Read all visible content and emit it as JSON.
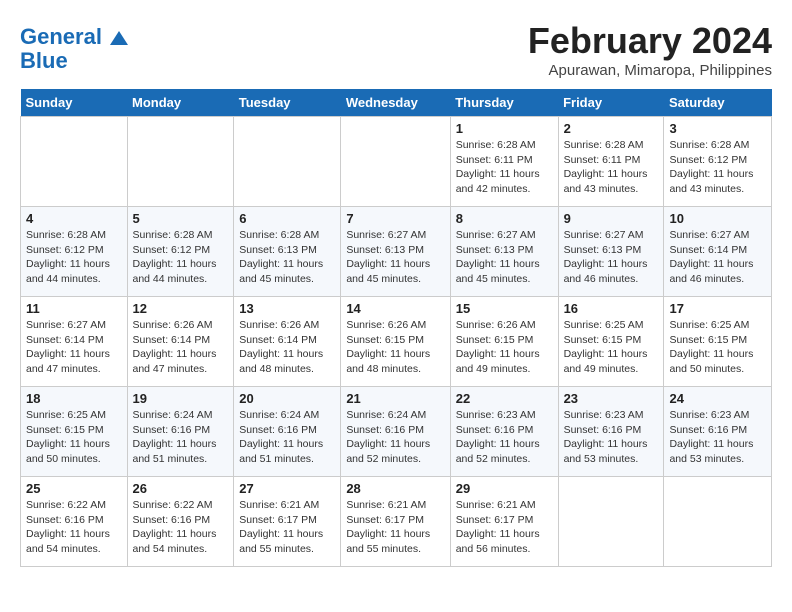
{
  "header": {
    "logo_line1": "General",
    "logo_line2": "Blue",
    "month_year": "February 2024",
    "location": "Apurawan, Mimaropa, Philippines"
  },
  "days_of_week": [
    "Sunday",
    "Monday",
    "Tuesday",
    "Wednesday",
    "Thursday",
    "Friday",
    "Saturday"
  ],
  "weeks": [
    [
      {
        "day": "",
        "empty": true
      },
      {
        "day": "",
        "empty": true
      },
      {
        "day": "",
        "empty": true
      },
      {
        "day": "",
        "empty": true
      },
      {
        "day": "1",
        "sunrise": "6:28 AM",
        "sunset": "6:11 PM",
        "daylight": "11 hours and 42 minutes."
      },
      {
        "day": "2",
        "sunrise": "6:28 AM",
        "sunset": "6:11 PM",
        "daylight": "11 hours and 43 minutes."
      },
      {
        "day": "3",
        "sunrise": "6:28 AM",
        "sunset": "6:12 PM",
        "daylight": "11 hours and 43 minutes."
      }
    ],
    [
      {
        "day": "4",
        "sunrise": "6:28 AM",
        "sunset": "6:12 PM",
        "daylight": "11 hours and 44 minutes."
      },
      {
        "day": "5",
        "sunrise": "6:28 AM",
        "sunset": "6:12 PM",
        "daylight": "11 hours and 44 minutes."
      },
      {
        "day": "6",
        "sunrise": "6:28 AM",
        "sunset": "6:13 PM",
        "daylight": "11 hours and 45 minutes."
      },
      {
        "day": "7",
        "sunrise": "6:27 AM",
        "sunset": "6:13 PM",
        "daylight": "11 hours and 45 minutes."
      },
      {
        "day": "8",
        "sunrise": "6:27 AM",
        "sunset": "6:13 PM",
        "daylight": "11 hours and 45 minutes."
      },
      {
        "day": "9",
        "sunrise": "6:27 AM",
        "sunset": "6:13 PM",
        "daylight": "11 hours and 46 minutes."
      },
      {
        "day": "10",
        "sunrise": "6:27 AM",
        "sunset": "6:14 PM",
        "daylight": "11 hours and 46 minutes."
      }
    ],
    [
      {
        "day": "11",
        "sunrise": "6:27 AM",
        "sunset": "6:14 PM",
        "daylight": "11 hours and 47 minutes."
      },
      {
        "day": "12",
        "sunrise": "6:26 AM",
        "sunset": "6:14 PM",
        "daylight": "11 hours and 47 minutes."
      },
      {
        "day": "13",
        "sunrise": "6:26 AM",
        "sunset": "6:14 PM",
        "daylight": "11 hours and 48 minutes."
      },
      {
        "day": "14",
        "sunrise": "6:26 AM",
        "sunset": "6:15 PM",
        "daylight": "11 hours and 48 minutes."
      },
      {
        "day": "15",
        "sunrise": "6:26 AM",
        "sunset": "6:15 PM",
        "daylight": "11 hours and 49 minutes."
      },
      {
        "day": "16",
        "sunrise": "6:25 AM",
        "sunset": "6:15 PM",
        "daylight": "11 hours and 49 minutes."
      },
      {
        "day": "17",
        "sunrise": "6:25 AM",
        "sunset": "6:15 PM",
        "daylight": "11 hours and 50 minutes."
      }
    ],
    [
      {
        "day": "18",
        "sunrise": "6:25 AM",
        "sunset": "6:15 PM",
        "daylight": "11 hours and 50 minutes."
      },
      {
        "day": "19",
        "sunrise": "6:24 AM",
        "sunset": "6:16 PM",
        "daylight": "11 hours and 51 minutes."
      },
      {
        "day": "20",
        "sunrise": "6:24 AM",
        "sunset": "6:16 PM",
        "daylight": "11 hours and 51 minutes."
      },
      {
        "day": "21",
        "sunrise": "6:24 AM",
        "sunset": "6:16 PM",
        "daylight": "11 hours and 52 minutes."
      },
      {
        "day": "22",
        "sunrise": "6:23 AM",
        "sunset": "6:16 PM",
        "daylight": "11 hours and 52 minutes."
      },
      {
        "day": "23",
        "sunrise": "6:23 AM",
        "sunset": "6:16 PM",
        "daylight": "11 hours and 53 minutes."
      },
      {
        "day": "24",
        "sunrise": "6:23 AM",
        "sunset": "6:16 PM",
        "daylight": "11 hours and 53 minutes."
      }
    ],
    [
      {
        "day": "25",
        "sunrise": "6:22 AM",
        "sunset": "6:16 PM",
        "daylight": "11 hours and 54 minutes."
      },
      {
        "day": "26",
        "sunrise": "6:22 AM",
        "sunset": "6:16 PM",
        "daylight": "11 hours and 54 minutes."
      },
      {
        "day": "27",
        "sunrise": "6:21 AM",
        "sunset": "6:17 PM",
        "daylight": "11 hours and 55 minutes."
      },
      {
        "day": "28",
        "sunrise": "6:21 AM",
        "sunset": "6:17 PM",
        "daylight": "11 hours and 55 minutes."
      },
      {
        "day": "29",
        "sunrise": "6:21 AM",
        "sunset": "6:17 PM",
        "daylight": "11 hours and 56 minutes."
      },
      {
        "day": "",
        "empty": true
      },
      {
        "day": "",
        "empty": true
      }
    ]
  ]
}
